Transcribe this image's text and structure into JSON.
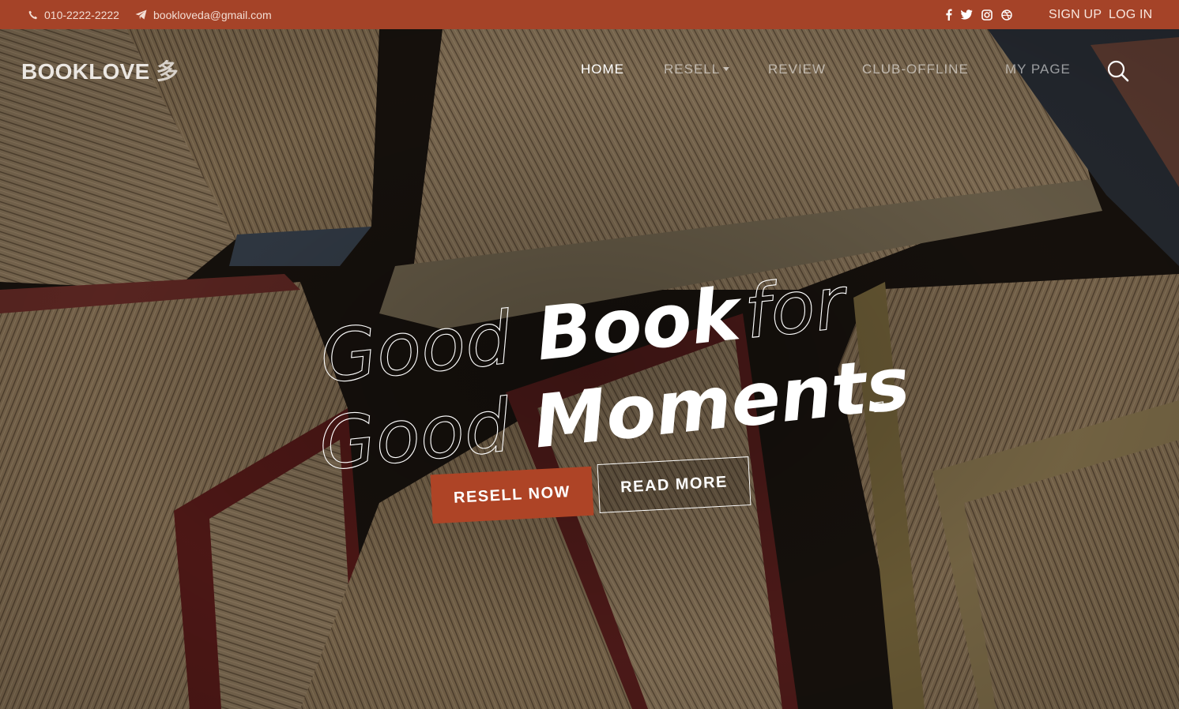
{
  "topbar": {
    "phone": "010-2222-2222",
    "email": "bookloveda@gmail.com",
    "social_icons": [
      "facebook-icon",
      "twitter-icon",
      "instagram-icon",
      "dribbble-icon"
    ],
    "sign_up": "SIGN UP",
    "log_in": "LOG IN"
  },
  "brand": {
    "name": "BOOKLOVE",
    "glyph": "多"
  },
  "nav": {
    "items": [
      {
        "label": "HOME",
        "active": true
      },
      {
        "label": "RESELL",
        "dropdown": true
      },
      {
        "label": "REVIEW"
      },
      {
        "label": "CLUB-OFFLINE"
      },
      {
        "label": "MY PAGE"
      }
    ],
    "search_icon": "search-icon"
  },
  "hero": {
    "line1": {
      "outline": "Good",
      "solid": "Book",
      "outline_end": "for"
    },
    "line2": {
      "outline": "Good",
      "solid": "Moments",
      "dot": "."
    },
    "primary_button": "RESELL NOW",
    "secondary_button": "READ MORE"
  },
  "colors": {
    "brand_accent": "#a54328",
    "button_accent": "#ae4426",
    "text_light": "#ffffff"
  }
}
